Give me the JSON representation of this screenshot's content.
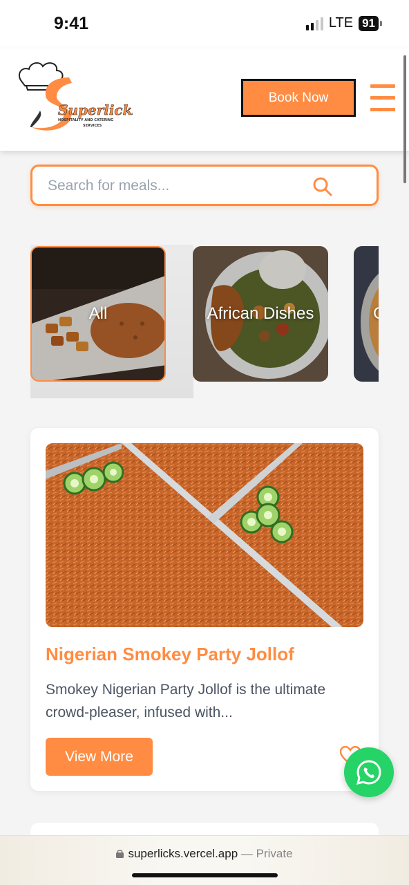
{
  "status_bar": {
    "time": "9:41",
    "network": "LTE",
    "battery": "91"
  },
  "header": {
    "logo_text": "Superlicks",
    "logo_tagline": "HOSPITALITY AND CATERING SERVICES",
    "book_now_label": "Book Now",
    "menu_icon": "hamburger-menu-icon"
  },
  "search": {
    "placeholder": "Search for meals...",
    "value": "",
    "icon": "search-icon"
  },
  "categories": [
    {
      "label": "All",
      "active": true
    },
    {
      "label": "African Dishes",
      "active": false
    },
    {
      "label": "C",
      "active": false
    }
  ],
  "meal": {
    "title": "Nigerian Smokey Party Jollof",
    "description": "Smokey Nigerian Party Jollof is the ultimate crowd-pleaser, infused with...",
    "view_more_label": "View More",
    "favorite_icon": "heart-icon"
  },
  "browser": {
    "url": "superlicks.vercel.app",
    "separator": " — ",
    "mode": "Private"
  },
  "colors": {
    "accent": "#ff8c42",
    "whatsapp": "#25d366",
    "text_muted": "#4b5563"
  }
}
